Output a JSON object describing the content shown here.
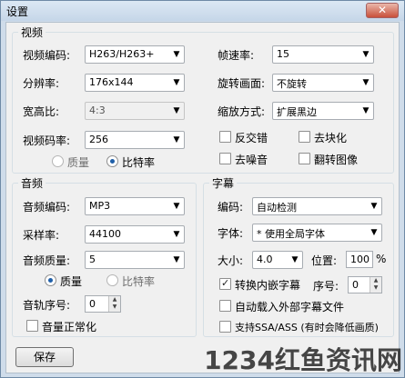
{
  "window": {
    "title": "设置",
    "close_symbol": "✕"
  },
  "video": {
    "group_title": "视频",
    "codec": {
      "label": "视频编码:",
      "value": "H263/H263+"
    },
    "resolution": {
      "label": "分辨率:",
      "value": "176x144"
    },
    "aspect": {
      "label": "宽高比:",
      "value": "4:3"
    },
    "bitrate": {
      "label": "视频码率:",
      "value": "256"
    },
    "framerate": {
      "label": "帧速率:",
      "value": "15"
    },
    "rotate": {
      "label": "旋转画面:",
      "value": "不旋转"
    },
    "scale": {
      "label": "缩放方式:",
      "value": "扩展黑边"
    },
    "checks": [
      {
        "label": "反交错",
        "checked": false
      },
      {
        "label": "去块化",
        "checked": false
      },
      {
        "label": "去噪音",
        "checked": false
      },
      {
        "label": "翻转图像",
        "checked": false
      }
    ],
    "mode_quality": "质量",
    "mode_bitrate": "比特率",
    "mode_selected": "比特率"
  },
  "audio": {
    "group_title": "音频",
    "codec": {
      "label": "音频编码:",
      "value": "MP3"
    },
    "samplerate": {
      "label": "采样率:",
      "value": "44100"
    },
    "quality": {
      "label": "音频质量:",
      "value": "5"
    },
    "mode_quality": "质量",
    "mode_bitrate": "比特率",
    "mode_selected": "质量",
    "track": {
      "label": "音轨序号:",
      "value": "0"
    },
    "normalize": {
      "label": "音量正常化",
      "checked": false
    }
  },
  "subtitle": {
    "group_title": "字幕",
    "encoding": {
      "label": "编码:",
      "value": "自动检测"
    },
    "font": {
      "label": "字体:",
      "value": "* 使用全局字体"
    },
    "size": {
      "label": "大小:",
      "value": "4.0"
    },
    "position": {
      "label": "位置:",
      "value": "100",
      "unit": "%"
    },
    "convert_embedded": {
      "label": "转换内嵌字幕",
      "checked": true
    },
    "index": {
      "label": "序号:",
      "value": "0"
    },
    "auto_load": {
      "label": "自动载入外部字幕文件",
      "checked": false
    },
    "ssa": {
      "label": "支持SSA/ASS (有时会降低画质)",
      "checked": false
    }
  },
  "footer": {
    "save_label": "保存"
  },
  "watermark": "1234红鱼资讯网",
  "colors": {
    "window_frame": "#cfdcea",
    "client_bg": "#f0f0f0",
    "radio_dot": "#1f5fa8"
  }
}
